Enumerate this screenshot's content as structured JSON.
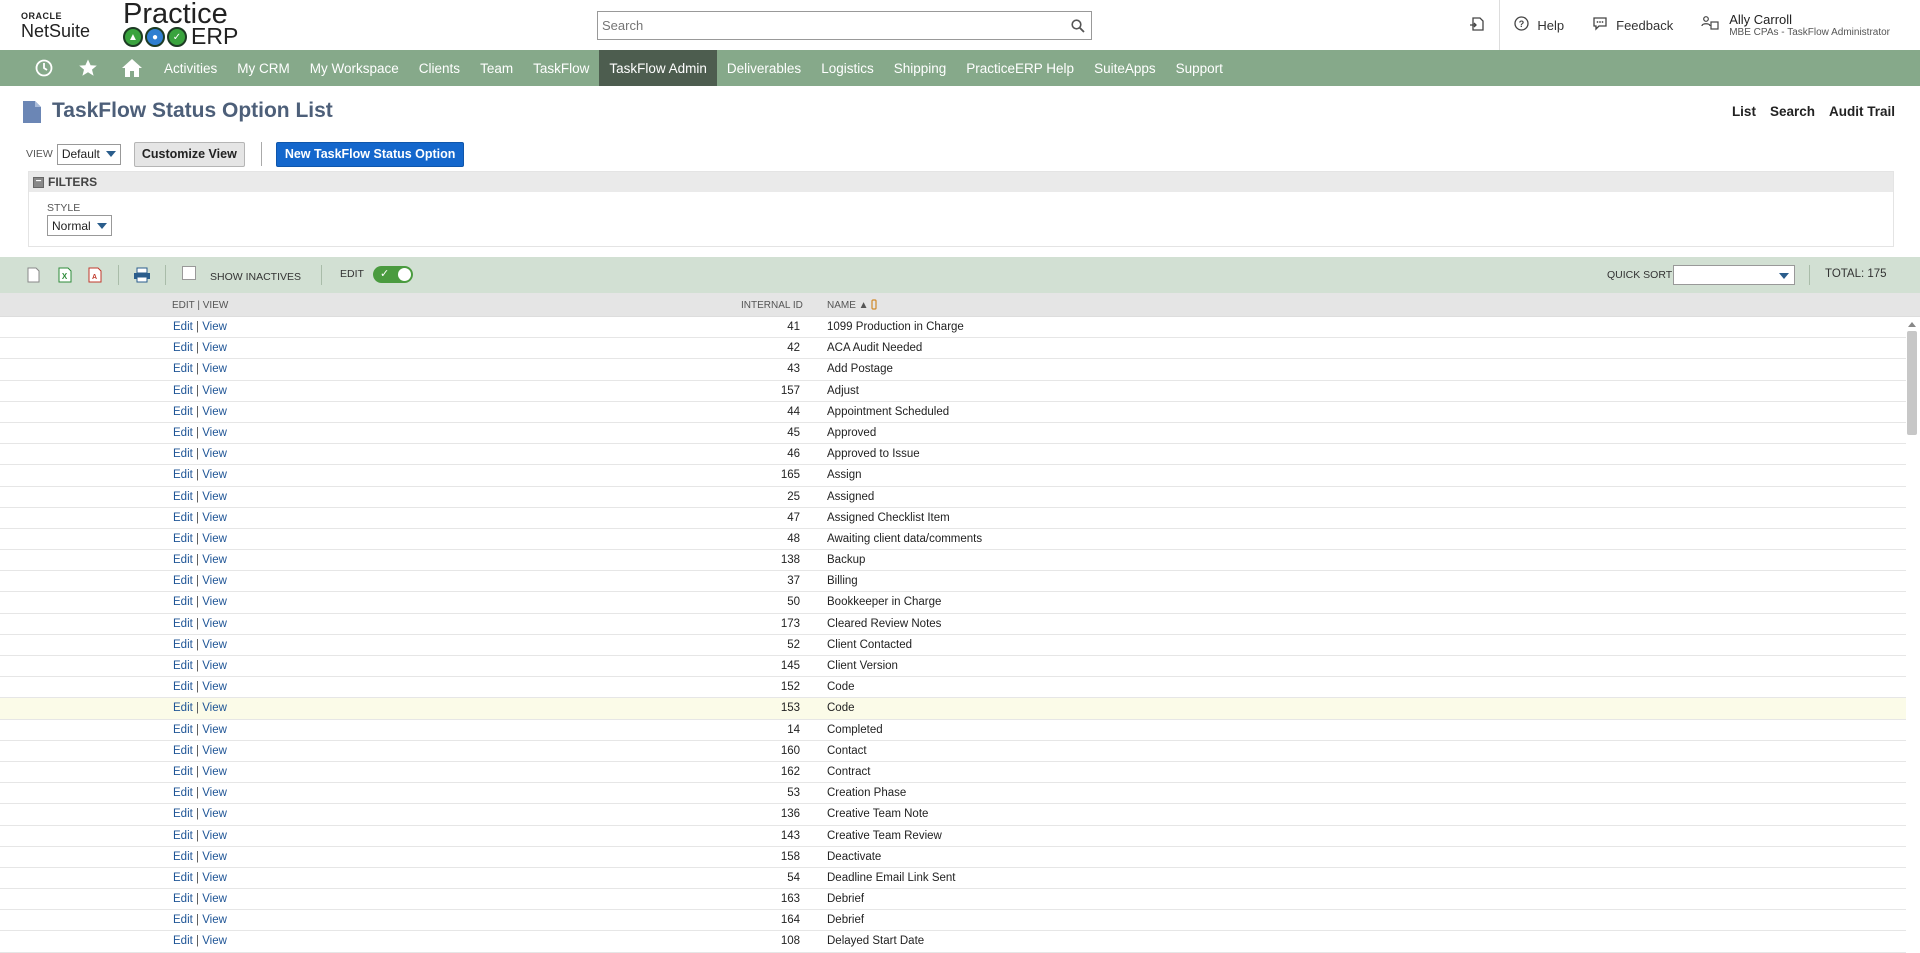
{
  "brand": {
    "oracle": "ORACLE",
    "netsuite": "NetSuite",
    "practice": "Practice",
    "erp": "ERP"
  },
  "search": {
    "placeholder": "Search"
  },
  "top_links": {
    "help": "Help",
    "feedback": "Feedback"
  },
  "user": {
    "name": "Ally Carroll",
    "role": "MBE CPAs - TaskFlow Administrator"
  },
  "nav": {
    "items": [
      {
        "label": "Activities"
      },
      {
        "label": "My CRM"
      },
      {
        "label": "My Workspace"
      },
      {
        "label": "Clients"
      },
      {
        "label": "Team"
      },
      {
        "label": "TaskFlow"
      },
      {
        "label": "TaskFlow Admin"
      },
      {
        "label": "Deliverables"
      },
      {
        "label": "Logistics"
      },
      {
        "label": "Shipping"
      },
      {
        "label": "PracticeERP Help"
      },
      {
        "label": "SuiteApps"
      },
      {
        "label": "Support"
      }
    ],
    "active_index": 6
  },
  "page": {
    "title": "TaskFlow Status Option List",
    "links": {
      "list": "List",
      "search": "Search",
      "audit_trail": "Audit Trail"
    }
  },
  "toolbar": {
    "view_label": "VIEW",
    "view_value": "Default",
    "customize_view": "Customize View",
    "new_button": "New TaskFlow Status Option"
  },
  "filters": {
    "title": "FILTERS",
    "style_label": "STYLE",
    "style_value": "Normal"
  },
  "listbar": {
    "show_inactives": "SHOW INACTIVES",
    "edit_label": "EDIT",
    "quick_sort_label": "QUICK SORT",
    "total": "TOTAL: 175"
  },
  "table": {
    "headers": {
      "edit_view": "EDIT | VIEW",
      "internal_id": "INTERNAL ID",
      "name": "NAME ▲"
    },
    "edit_text": "Edit",
    "view_text": "View",
    "rows": [
      {
        "id": "41",
        "name": "1099 Production in Charge"
      },
      {
        "id": "42",
        "name": "ACA Audit Needed"
      },
      {
        "id": "43",
        "name": "Add Postage"
      },
      {
        "id": "157",
        "name": "Adjust"
      },
      {
        "id": "44",
        "name": "Appointment Scheduled"
      },
      {
        "id": "45",
        "name": "Approved"
      },
      {
        "id": "46",
        "name": "Approved to Issue"
      },
      {
        "id": "165",
        "name": "Assign"
      },
      {
        "id": "25",
        "name": "Assigned"
      },
      {
        "id": "47",
        "name": "Assigned Checklist Item"
      },
      {
        "id": "48",
        "name": "Awaiting client data/comments"
      },
      {
        "id": "138",
        "name": "Backup"
      },
      {
        "id": "37",
        "name": "Billing"
      },
      {
        "id": "50",
        "name": "Bookkeeper in Charge"
      },
      {
        "id": "173",
        "name": "Cleared Review Notes"
      },
      {
        "id": "52",
        "name": "Client Contacted"
      },
      {
        "id": "145",
        "name": "Client Version"
      },
      {
        "id": "152",
        "name": "Code"
      },
      {
        "id": "153",
        "name": "Code"
      },
      {
        "id": "14",
        "name": "Completed"
      },
      {
        "id": "160",
        "name": "Contact"
      },
      {
        "id": "162",
        "name": "Contract"
      },
      {
        "id": "53",
        "name": "Creation Phase"
      },
      {
        "id": "136",
        "name": "Creative Team Note"
      },
      {
        "id": "143",
        "name": "Creative Team Review"
      },
      {
        "id": "158",
        "name": "Deactivate"
      },
      {
        "id": "54",
        "name": "Deadline Email Link Sent"
      },
      {
        "id": "163",
        "name": "Debrief"
      },
      {
        "id": "164",
        "name": "Debrief"
      },
      {
        "id": "108",
        "name": "Delayed Start Date"
      }
    ],
    "highlight_index": 18
  },
  "colors": {
    "nav_bg": "#86a98a",
    "nav_active": "#4d5d4f",
    "title": "#4d5f79",
    "primary_button": "#1467cc",
    "listbar_bg": "#d2e0d3",
    "link": "#1f5596"
  }
}
